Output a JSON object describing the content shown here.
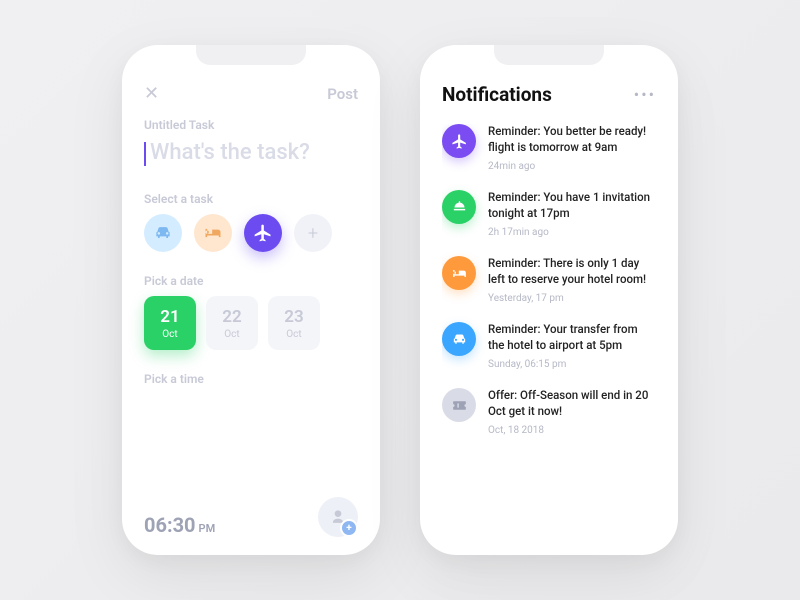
{
  "left": {
    "close_label": "✕",
    "post_label": "Post",
    "title_label": "Untitled Task",
    "input_placeholder": "What's the task?",
    "select_label": "Select a task",
    "add_icon_label": "+",
    "pick_date_label": "Pick a date",
    "dates": [
      {
        "day": "21",
        "mon": "Oct"
      },
      {
        "day": "22",
        "mon": "Oct"
      },
      {
        "day": "23",
        "mon": "Oct"
      }
    ],
    "pick_time_label": "Pick a time",
    "time_value": "06:30",
    "time_suffix": "PM"
  },
  "right": {
    "title": "Notifications",
    "more_label": "•••",
    "items": [
      {
        "text": "Reminder: You better be ready! flight is tomorrow at 9am",
        "time": "24min ago"
      },
      {
        "text": "Reminder: You have 1 invitation tonight at 17pm",
        "time": "2h 17min ago"
      },
      {
        "text": "Reminder: There is only 1 day left to reserve your hotel room!",
        "time": "Yesterday, 17 pm"
      },
      {
        "text": "Reminder: Your transfer from the hotel to airport at 5pm",
        "time": "Sunday, 06:15 pm"
      },
      {
        "text": "Offer: Off-Season will end  in 20 Oct get it now!",
        "time": "Oct, 18 2018"
      }
    ]
  }
}
